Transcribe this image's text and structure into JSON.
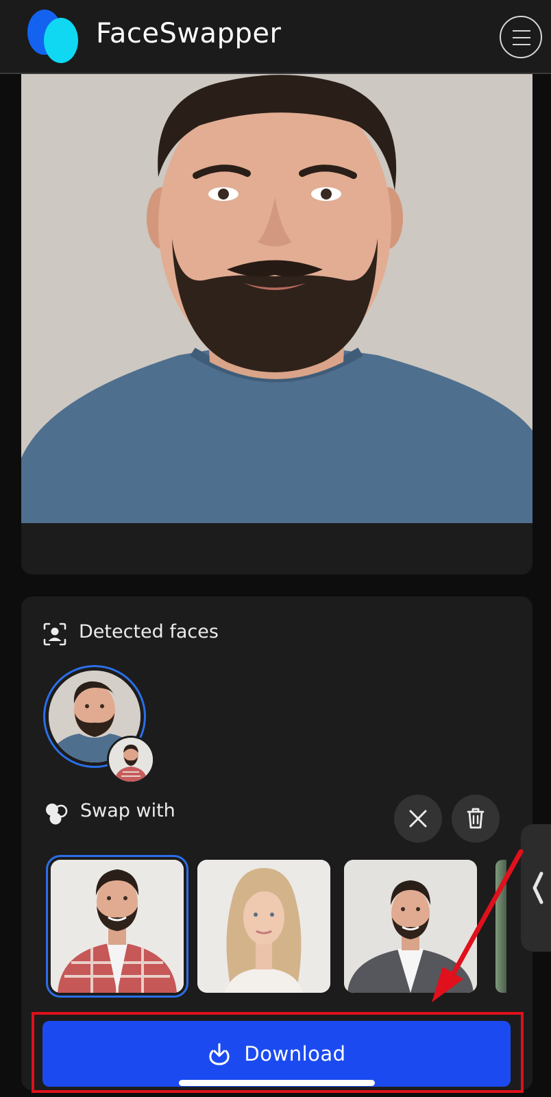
{
  "header": {
    "app_name": "FaceSwapper",
    "menu_icon": "hamburger-icon"
  },
  "detected_faces": {
    "label": "Detected faces",
    "icon": "face-scan-icon"
  },
  "swap_with": {
    "label": "Swap with",
    "icon": "swap-faces-icon",
    "clear_icon": "close-icon",
    "delete_icon": "trash-icon"
  },
  "download": {
    "label": "Download",
    "icon": "download-icon"
  },
  "colors": {
    "accent": "#1b4bf0",
    "selection": "#2b6fe8",
    "highlight": "#e0101c",
    "logo_primary": "#1463f0",
    "logo_secondary": "#10d8f2"
  }
}
